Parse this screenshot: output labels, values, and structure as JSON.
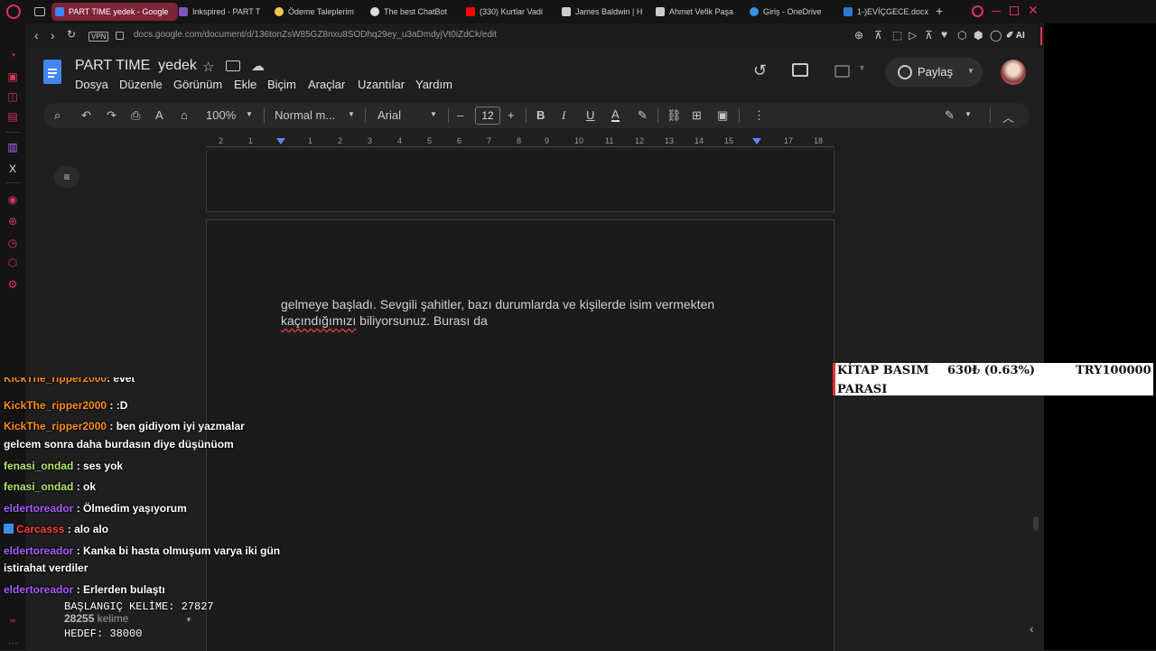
{
  "browser": {
    "tabs": [
      {
        "title": "PART TIME yedek - Google",
        "active": true,
        "color": "#4285f4"
      },
      {
        "title": "Inkspired - PART T",
        "active": false,
        "color": "#7e57c2"
      },
      {
        "title": "Ödeme Taleplerim",
        "active": false,
        "color": "#f2c94c"
      },
      {
        "title": "The best ChatBot",
        "active": false,
        "color": "#dddddd"
      },
      {
        "title": "(330) Kurtlar Vadi",
        "active": false,
        "color": "#ff0000"
      },
      {
        "title": "James Baldwin | H",
        "active": false,
        "color": "#cccccc"
      },
      {
        "title": "Ahmet Vefik Paşa",
        "active": false,
        "color": "#cccccc"
      },
      {
        "title": "Giriş - OneDrive",
        "active": false,
        "color": "#3a8ee6"
      },
      {
        "title": "1-)EVİÇGECE.docx",
        "active": false,
        "color": "#2b7cd3"
      }
    ],
    "vpn_label": "VPN",
    "url": "docs.google.com/document/d/136tonZsW85GZ8nxu8SODhq29ey_u3aDmdyjVt0iZdCk/edit",
    "ai_label": "AI"
  },
  "docs": {
    "title": "PART TIME  yedek",
    "menus": [
      "Dosya",
      "Düzenle",
      "Görünüm",
      "Ekle",
      "Biçim",
      "Araçlar",
      "Uzantılar",
      "Yardım"
    ],
    "share_label": "Paylaş",
    "zoom": "100%",
    "style": "Normal m...",
    "font": "Arial",
    "font_size": "12",
    "ruler": [
      "2",
      "1",
      "1",
      "2",
      "3",
      "4",
      "5",
      "6",
      "7",
      "8",
      "9",
      "10",
      "11",
      "12",
      "13",
      "14",
      "15",
      "16",
      "17",
      "18"
    ],
    "body_lines": [
      "gelmeye başladı. Sevgili şahitler, bazı durumlarda ve kişilerde isim vermekten",
      "kaçındığımızı",
      " biliyorsunuz. Burası da"
    ],
    "word_count_value": "28255",
    "word_count_label": "kelime"
  },
  "chat": [
    {
      "user": "KickThe_ripper2000",
      "msg": ": evet",
      "color": "#ff8c1a"
    },
    {
      "user": "KickThe_ripper2000",
      "msg": ": :D",
      "color": "#ff8c1a"
    },
    {
      "user": "KickThe_ripper2000",
      "msg": ": ben gidiyom iyi yazmalar",
      "color": "#ff8c1a",
      "cont": "gelcem sonra daha burdasın diye düşünüom"
    },
    {
      "user": "fenasi_ondad",
      "msg": ": ses yok",
      "color": "#b5e36b"
    },
    {
      "user": "fenasi_ondad",
      "msg": ": ok",
      "color": "#b5e36b"
    },
    {
      "user": "eldertoreador",
      "msg": ": Ölmedim yaşıyorum",
      "color": "#a95cff"
    },
    {
      "user": "Carcasss",
      "msg": ": alo alo",
      "color": "#ff4040"
    },
    {
      "user": "eldertoreador",
      "msg": ": Kanka bi hasta olmuşum varya iki gün",
      "color": "#a95cff",
      "cont": "istirahat verdiler"
    },
    {
      "user": "eldertoreador",
      "msg": ": Erlerden bulaştı",
      "color": "#a95cff"
    }
  ],
  "overlay": {
    "start_label": "BAŞLANGIÇ KELİME: 27827",
    "target_label": "HEDEF: 38000",
    "stat_title_1": "KİTAP BASIM",
    "stat_title_2": "PARASI",
    "stat_value": "630₺ (0.63%)",
    "stat_goal": "TRY100000"
  }
}
